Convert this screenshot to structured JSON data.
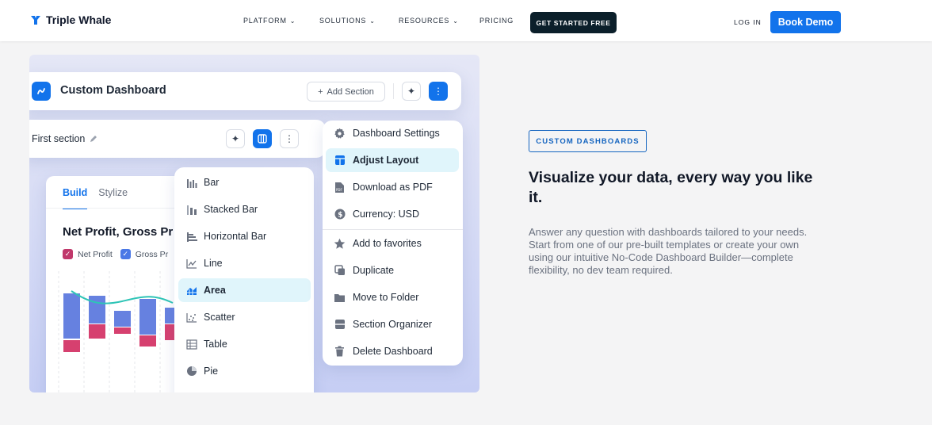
{
  "nav": {
    "brand": "Triple Whale",
    "links": [
      "PLATFORM",
      "SOLUTIONS",
      "RESOURCES",
      "PRICING"
    ],
    "cta": "GET STARTED FREE",
    "login": "LOG IN",
    "demo": "Book Demo"
  },
  "dashboard": {
    "title": "Custom Dashboard",
    "add_section": "Add Section",
    "section_name": "First section"
  },
  "chart_card": {
    "tabs": [
      "Build",
      "Stylize"
    ],
    "title": "Net Profit, Gross Pr",
    "legend": [
      "Net Profit",
      "Gross Pr"
    ],
    "colors": {
      "top_bar": "#6681e0",
      "bottom_bar": "#d6406f",
      "line": "#2ec4b6",
      "legend_net": "#c0386b",
      "legend_gross": "#4a78e6"
    }
  },
  "chart_types": [
    {
      "label": "Bar",
      "icon": "bar-chart-icon"
    },
    {
      "label": "Stacked Bar",
      "icon": "stacked-bar-icon"
    },
    {
      "label": "Horizontal Bar",
      "icon": "horizontal-bar-icon"
    },
    {
      "label": "Line",
      "icon": "line-chart-icon"
    },
    {
      "label": "Area",
      "icon": "area-chart-icon"
    },
    {
      "label": "Scatter",
      "icon": "scatter-icon"
    },
    {
      "label": "Table",
      "icon": "table-icon"
    },
    {
      "label": "Pie",
      "icon": "pie-chart-icon"
    }
  ],
  "dashboard_actions": [
    {
      "label": "Dashboard Settings",
      "icon": "gear-icon"
    },
    {
      "label": "Adjust Layout",
      "icon": "layout-icon"
    },
    {
      "label": "Download as PDF",
      "icon": "pdf-icon"
    },
    {
      "label": "Currency: USD",
      "icon": "dollar-icon"
    },
    {
      "label": "Add to favorites",
      "icon": "star-icon"
    },
    {
      "label": "Duplicate",
      "icon": "duplicate-icon"
    },
    {
      "label": "Move to Folder",
      "icon": "folder-icon"
    },
    {
      "label": "Section Organizer",
      "icon": "organizer-icon"
    },
    {
      "label": "Delete Dashboard",
      "icon": "trash-icon"
    }
  ],
  "copy": {
    "eyebrow": "CUSTOM DASHBOARDS",
    "headline": "Visualize your data, every way you like it.",
    "body": "Answer any question with dashboards tailored to your needs. Start from one of our pre-built templates or create your own using our intuitive No-Code Dashboard Builder—complete flexibility, no dev team required."
  }
}
